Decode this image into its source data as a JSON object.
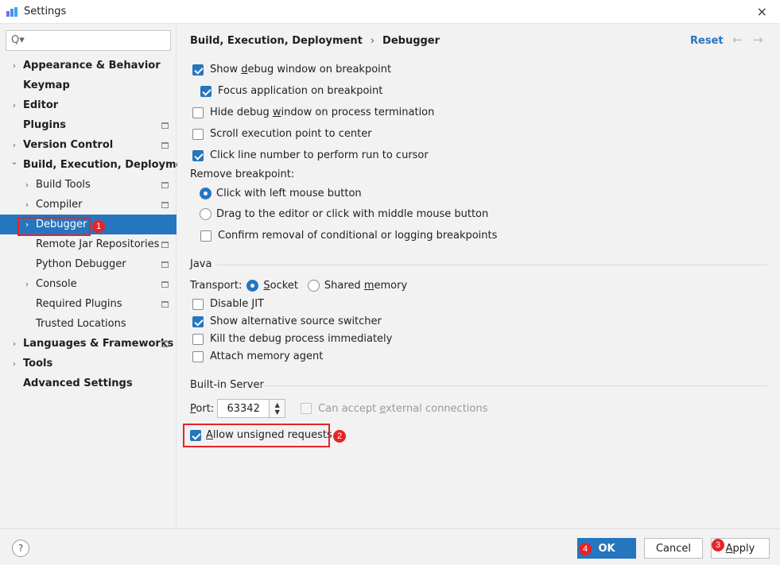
{
  "window": {
    "title": "Settings",
    "close_icon": "×"
  },
  "search": {
    "icon": "Q▾",
    "value": ""
  },
  "sidebar": {
    "items": [
      {
        "label": "Appearance & Behavior",
        "bold": true,
        "expandable": true,
        "page_icon": false
      },
      {
        "label": "Keymap",
        "bold": true,
        "expandable": false,
        "page_icon": false
      },
      {
        "label": "Editor",
        "bold": true,
        "expandable": true,
        "page_icon": false
      },
      {
        "label": "Plugins",
        "bold": true,
        "expandable": false,
        "page_icon": true
      },
      {
        "label": "Version Control",
        "bold": true,
        "expandable": true,
        "page_icon": true
      },
      {
        "label": "Build, Execution, Deployment",
        "bold": true,
        "expandable": true,
        "expanded": true,
        "page_icon": false
      },
      {
        "label": "Build Tools",
        "bold": false,
        "expandable": true,
        "page_icon": true
      },
      {
        "label": "Compiler",
        "bold": false,
        "expandable": true,
        "page_icon": true
      },
      {
        "label": "Debugger",
        "bold": false,
        "expandable": true,
        "page_icon": false,
        "selected": true
      },
      {
        "label": "Remote Jar Repositories",
        "bold": false,
        "expandable": false,
        "page_icon": true
      },
      {
        "label": "Python Debugger",
        "bold": false,
        "expandable": false,
        "page_icon": true
      },
      {
        "label": "Console",
        "bold": false,
        "expandable": true,
        "page_icon": true
      },
      {
        "label": "Required Plugins",
        "bold": false,
        "expandable": false,
        "page_icon": true
      },
      {
        "label": "Trusted Locations",
        "bold": false,
        "expandable": false,
        "page_icon": false
      },
      {
        "label": "Languages & Frameworks",
        "bold": true,
        "expandable": true,
        "page_icon": true
      },
      {
        "label": "Tools",
        "bold": true,
        "expandable": true,
        "page_icon": false
      },
      {
        "label": "Advanced Settings",
        "bold": true,
        "expandable": false,
        "page_icon": false
      }
    ]
  },
  "breadcrumb": {
    "parent": "Build, Execution, Deployment",
    "separator": "›",
    "current": "Debugger"
  },
  "header": {
    "reset_label": "Reset",
    "back_arrow": "←",
    "forward_arrow": "→"
  },
  "general": {
    "show_debug_window": {
      "pre": "Show ",
      "ul": "d",
      "post": "ebug window on breakpoint",
      "checked": true
    },
    "focus_application": {
      "label": "Focus application on breakpoint",
      "checked": true
    },
    "hide_debug_window": {
      "pre": "Hide debug ",
      "ul": "w",
      "post": "indow on process termination",
      "checked": false
    },
    "scroll_execution": {
      "label": "Scroll execution point to center",
      "checked": false
    },
    "click_line_number": {
      "label": "Click line number to perform run to cursor",
      "checked": true
    }
  },
  "remove_breakpoint": {
    "label": "Remove breakpoint:",
    "left_click": {
      "label": "Click with left mouse button",
      "selected": true
    },
    "drag": {
      "label": "Drag to the editor or click with middle mouse button",
      "selected": false
    },
    "confirm_removal": {
      "label": "Confirm removal of conditional or logging breakpoints",
      "checked": false
    }
  },
  "java": {
    "title": "Java",
    "transport_label": "Transport:",
    "socket": {
      "ul": "S",
      "post": "ocket",
      "selected": true
    },
    "shared_memory": {
      "pre": "Shared ",
      "ul": "m",
      "post": "emory",
      "selected": false
    },
    "disable_jit": {
      "label": "Disable JIT",
      "checked": false
    },
    "alt_source_switcher": {
      "label": "Show alternative source switcher",
      "checked": true
    },
    "kill_debug": {
      "label": "Kill the debug process immediately",
      "checked": false
    },
    "attach_memory_agent": {
      "label": "Attach memory agent",
      "checked": false
    }
  },
  "builtin_server": {
    "title": "Built-in Server",
    "port_label_ul": "P",
    "port_label_post": "ort:",
    "port_value": "63342",
    "spinner_up": "▲",
    "spinner_down": "▼",
    "external_connections": {
      "pre": "Can accept ",
      "ul": "e",
      "post": "xternal connections",
      "checked": false,
      "disabled": true
    },
    "allow_unsigned": {
      "ul": "A",
      "post": "llow unsigned requests",
      "checked": true
    }
  },
  "annotations": {
    "badge_1": "1",
    "badge_2": "2",
    "badge_3": "3",
    "badge_4": "4"
  },
  "footer": {
    "help_label": "?",
    "ok_label": "OK",
    "cancel_label": "Cancel",
    "apply_ul": "A",
    "apply_post": "pply"
  },
  "colors": {
    "accent": "#2675bf",
    "annotation_red": "#e5242a"
  }
}
